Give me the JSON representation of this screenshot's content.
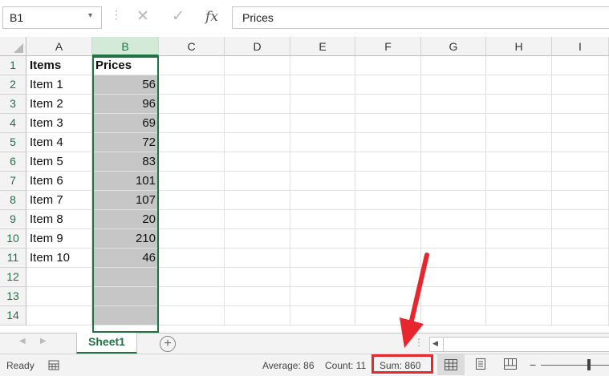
{
  "formula_bar": {
    "name_box": "B1",
    "name_box_arrow": "▾",
    "dots": "⋮",
    "cancel_icon": "✕",
    "enter_icon": "✓",
    "fx_icon": "fx",
    "formula_value": "Prices"
  },
  "columns": [
    "A",
    "B",
    "C",
    "D",
    "E",
    "F",
    "G",
    "H",
    "I"
  ],
  "rows": [
    "1",
    "2",
    "3",
    "4",
    "5",
    "6",
    "7",
    "8",
    "9",
    "10",
    "11",
    "12",
    "13",
    "14"
  ],
  "cells": {
    "A": [
      "Items",
      "Item 1",
      "Item 2",
      "Item 3",
      "Item 4",
      "Item 5",
      "Item 6",
      "Item 7",
      "Item 8",
      "Item 9",
      "Item 10"
    ],
    "B": [
      "Prices",
      "56",
      "96",
      "69",
      "72",
      "83",
      "101",
      "107",
      "20",
      "210",
      "46"
    ]
  },
  "sheet_tabs": {
    "active": "Sheet1",
    "add": "+"
  },
  "status_bar": {
    "mode": "Ready",
    "average": "Average: 86",
    "count": "Count: 11",
    "sum": "Sum: 860"
  },
  "colors": {
    "accent": "#217346",
    "highlight": "#e8262d",
    "selection": "#c6c6c6"
  }
}
